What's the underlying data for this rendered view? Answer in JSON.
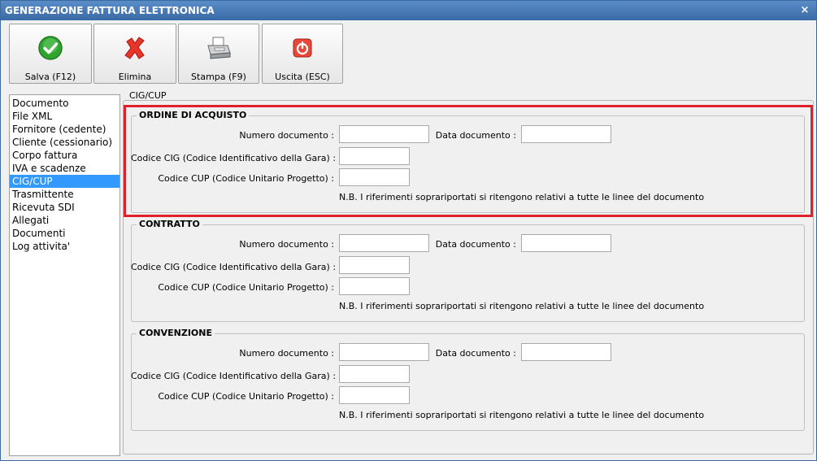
{
  "window": {
    "title": "GENERAZIONE FATTURA ELETTRONICA",
    "close_glyph": "×"
  },
  "toolbar": {
    "buttons": [
      {
        "label": "Salva (F12)",
        "icon": "check-icon"
      },
      {
        "label": "Elimina",
        "icon": "delete-x-icon"
      },
      {
        "label": "Stampa (F9)",
        "icon": "printer-icon"
      },
      {
        "label": "Uscita (ESC)",
        "icon": "exit-icon"
      }
    ]
  },
  "sidebar": {
    "items": [
      {
        "label": "Documento"
      },
      {
        "label": "File XML"
      },
      {
        "label": "Fornitore (cedente)"
      },
      {
        "label": "Cliente (cessionario)"
      },
      {
        "label": "Corpo fattura"
      },
      {
        "label": "IVA e scadenze"
      },
      {
        "label": "CIG/CUP",
        "selected": true
      },
      {
        "label": "Trasmittente"
      },
      {
        "label": "Ricevuta SDI"
      },
      {
        "label": "Allegati"
      },
      {
        "label": "Documenti"
      },
      {
        "label": "Log attivita'"
      }
    ]
  },
  "panel": {
    "title": "CIG/CUP",
    "groups": [
      {
        "title": "ORDINE DI ACQUISTO",
        "numero_label": "Numero documento :",
        "numero_value": "",
        "data_label": "Data documento :",
        "data_value": "",
        "cig_label": "Codice CIG (Codice Identificativo della Gara) :",
        "cig_value": "",
        "cup_label": "Codice CUP (Codice Unitario Progetto) :",
        "cup_value": "",
        "note": "N.B. I riferimenti soprariportati si ritengono relativi a tutte le linee del documento"
      },
      {
        "title": "CONTRATTO",
        "numero_label": "Numero documento :",
        "numero_value": "",
        "data_label": "Data documento :",
        "data_value": "",
        "cig_label": "Codice CIG (Codice Identificativo della Gara) :",
        "cig_value": "",
        "cup_label": "Codice CUP (Codice Unitario Progetto) :",
        "cup_value": "",
        "note": "N.B. I riferimenti soprariportati si ritengono relativi a tutte le linee del documento"
      },
      {
        "title": "CONVENZIONE",
        "numero_label": "Numero documento :",
        "numero_value": "",
        "data_label": "Data documento :",
        "data_value": "",
        "cig_label": "Codice CIG (Codice Identificativo della Gara) :",
        "cig_value": "",
        "cup_label": "Codice CUP (Codice Unitario Progetto) :",
        "cup_value": "",
        "note": "N.B. I riferimenti soprariportati si ritengono relativi a tutte le linee del documento"
      }
    ]
  },
  "colors": {
    "highlight": "#e0202a",
    "selection": "#3399ff",
    "titlebar": "#4a7cba"
  }
}
